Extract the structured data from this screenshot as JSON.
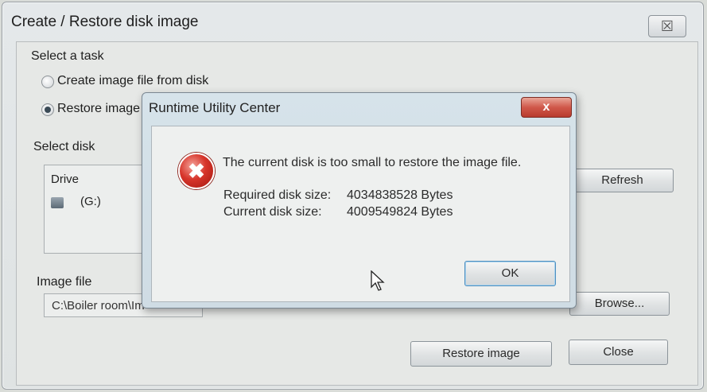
{
  "main_window": {
    "title": "Create / Restore disk image",
    "close_glyph": "☒"
  },
  "task_group": {
    "label": "Select a task",
    "options": [
      {
        "label": "Create image file from disk",
        "selected": false
      },
      {
        "label": "Restore image",
        "selected": true
      }
    ]
  },
  "disk_group": {
    "label": "Select disk",
    "column_header": "Drive",
    "drives": [
      {
        "label": "(G:)",
        "icon": "drive-icon"
      }
    ],
    "refresh_label": "Refresh"
  },
  "image_group": {
    "label": "Image file",
    "path_value": "C:\\Boiler room\\Im",
    "browse_label": "Browse..."
  },
  "footer": {
    "restore_label": "Restore image",
    "close_label": "Close"
  },
  "error_dialog": {
    "title": "Runtime Utility Center",
    "close_glyph": "x",
    "icon": "error-icon",
    "icon_glyph": "✖",
    "message": "The current disk is too small to restore the image file.",
    "required_label": "Required disk size:",
    "required_value": "4034838528 Bytes",
    "current_label": "Current disk size:",
    "current_value": "4009549824 Bytes",
    "ok_label": "OK"
  },
  "colors": {
    "error_red": "#d7352b",
    "dialog_tint": "#d6e3ea"
  }
}
